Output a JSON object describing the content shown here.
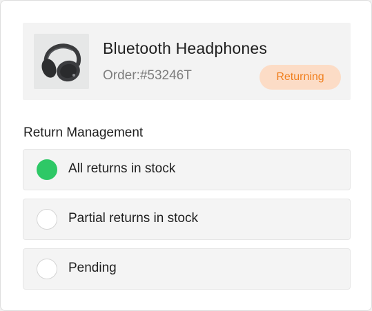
{
  "product": {
    "name": "Bluetooth Headphones",
    "order_id": "Order:#53246T",
    "status": "Returning",
    "image_icon": "headphones-icon"
  },
  "return_management": {
    "title": "Return Management",
    "options": [
      {
        "label": "All returns in stock",
        "checked": true
      },
      {
        "label": "Partial returns in stock",
        "checked": false
      },
      {
        "label": "Pending",
        "checked": false
      }
    ]
  },
  "colors": {
    "accent_green": "#2ec866",
    "status_bg": "#fcdcc6",
    "status_text": "#f07f1e"
  }
}
